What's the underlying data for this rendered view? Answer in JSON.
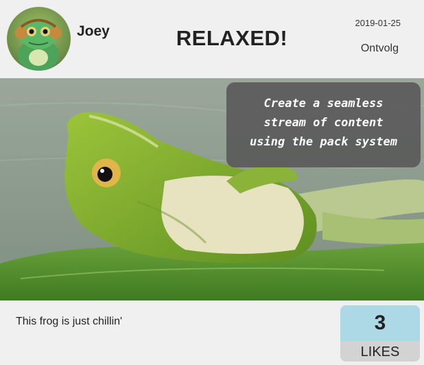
{
  "post": {
    "username": "Joey",
    "title": "RELAXED!",
    "date": "2019-01-25",
    "unfollow_label": "Ontvolg",
    "overlay_lines": [
      "Create a seamless",
      "stream of content",
      "using the pack system"
    ],
    "caption": "This frog is just chillin'",
    "likes": {
      "count": "3",
      "label": "LIKES"
    }
  },
  "icons": {
    "avatar": "frog-avatar-icon",
    "photo": "frog-photo"
  },
  "colors": {
    "background": "#f0f0f0",
    "likes_count_bg": "#add8e6",
    "likes_label_bg": "#d3d3d3",
    "overlay_bg": "#5a5a5a"
  }
}
